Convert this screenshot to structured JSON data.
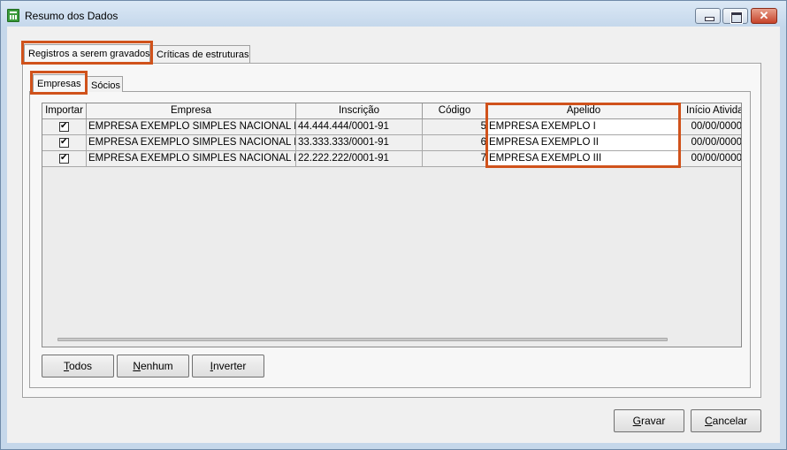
{
  "window": {
    "title": "Resumo dos Dados",
    "icon": "calculator-icon",
    "controls": {
      "minimize": "minimize-icon",
      "maximize": "maximize-icon",
      "close": "✕"
    }
  },
  "outer_tabs": [
    {
      "label": "Registros a serem gravados",
      "active": true,
      "highlighted": true
    },
    {
      "label": "Críticas de estruturas",
      "active": false
    }
  ],
  "inner_tabs": [
    {
      "label": "Empresas",
      "active": true,
      "highlighted": true
    },
    {
      "label": "Sócios",
      "active": false
    }
  ],
  "grid": {
    "columns": [
      "Importar",
      "Empresa",
      "Inscrição",
      "Código",
      "Apelido",
      "Início Atividade"
    ],
    "rows": [
      {
        "importar": true,
        "empresa": "EMPRESA EXEMPLO SIMPLES NACIONAL LTDA",
        "inscricao": "44.444.444/0001-91",
        "codigo": "5",
        "apelido": "EMPRESA EXEMPLO I",
        "inicio": "00/00/0000"
      },
      {
        "importar": true,
        "empresa": "EMPRESA EXEMPLO SIMPLES NACIONAL LTDA",
        "inscricao": "33.333.333/0001-91",
        "codigo": "6",
        "apelido": "EMPRESA EXEMPLO II",
        "inicio": "00/00/0000"
      },
      {
        "importar": true,
        "empresa": "EMPRESA EXEMPLO SIMPLES NACIONAL LTDA",
        "inscricao": "22.222.222/0001-91",
        "codigo": "7",
        "apelido": "EMPRESA EXEMPLO III",
        "inicio": "00/00/0000"
      }
    ]
  },
  "selection_buttons": {
    "todos": {
      "accel": "T",
      "rest": "odos"
    },
    "nenhum": {
      "accel": "N",
      "rest": "enhum"
    },
    "inverter": {
      "accel": "I",
      "rest": "nverter"
    }
  },
  "footer_buttons": {
    "gravar": {
      "accel": "G",
      "rest": "ravar"
    },
    "cancelar": {
      "accel": "C",
      "rest": "ancelar"
    }
  },
  "colors": {
    "highlight": "#d0521b",
    "window_frame": "#c5d7ea"
  }
}
